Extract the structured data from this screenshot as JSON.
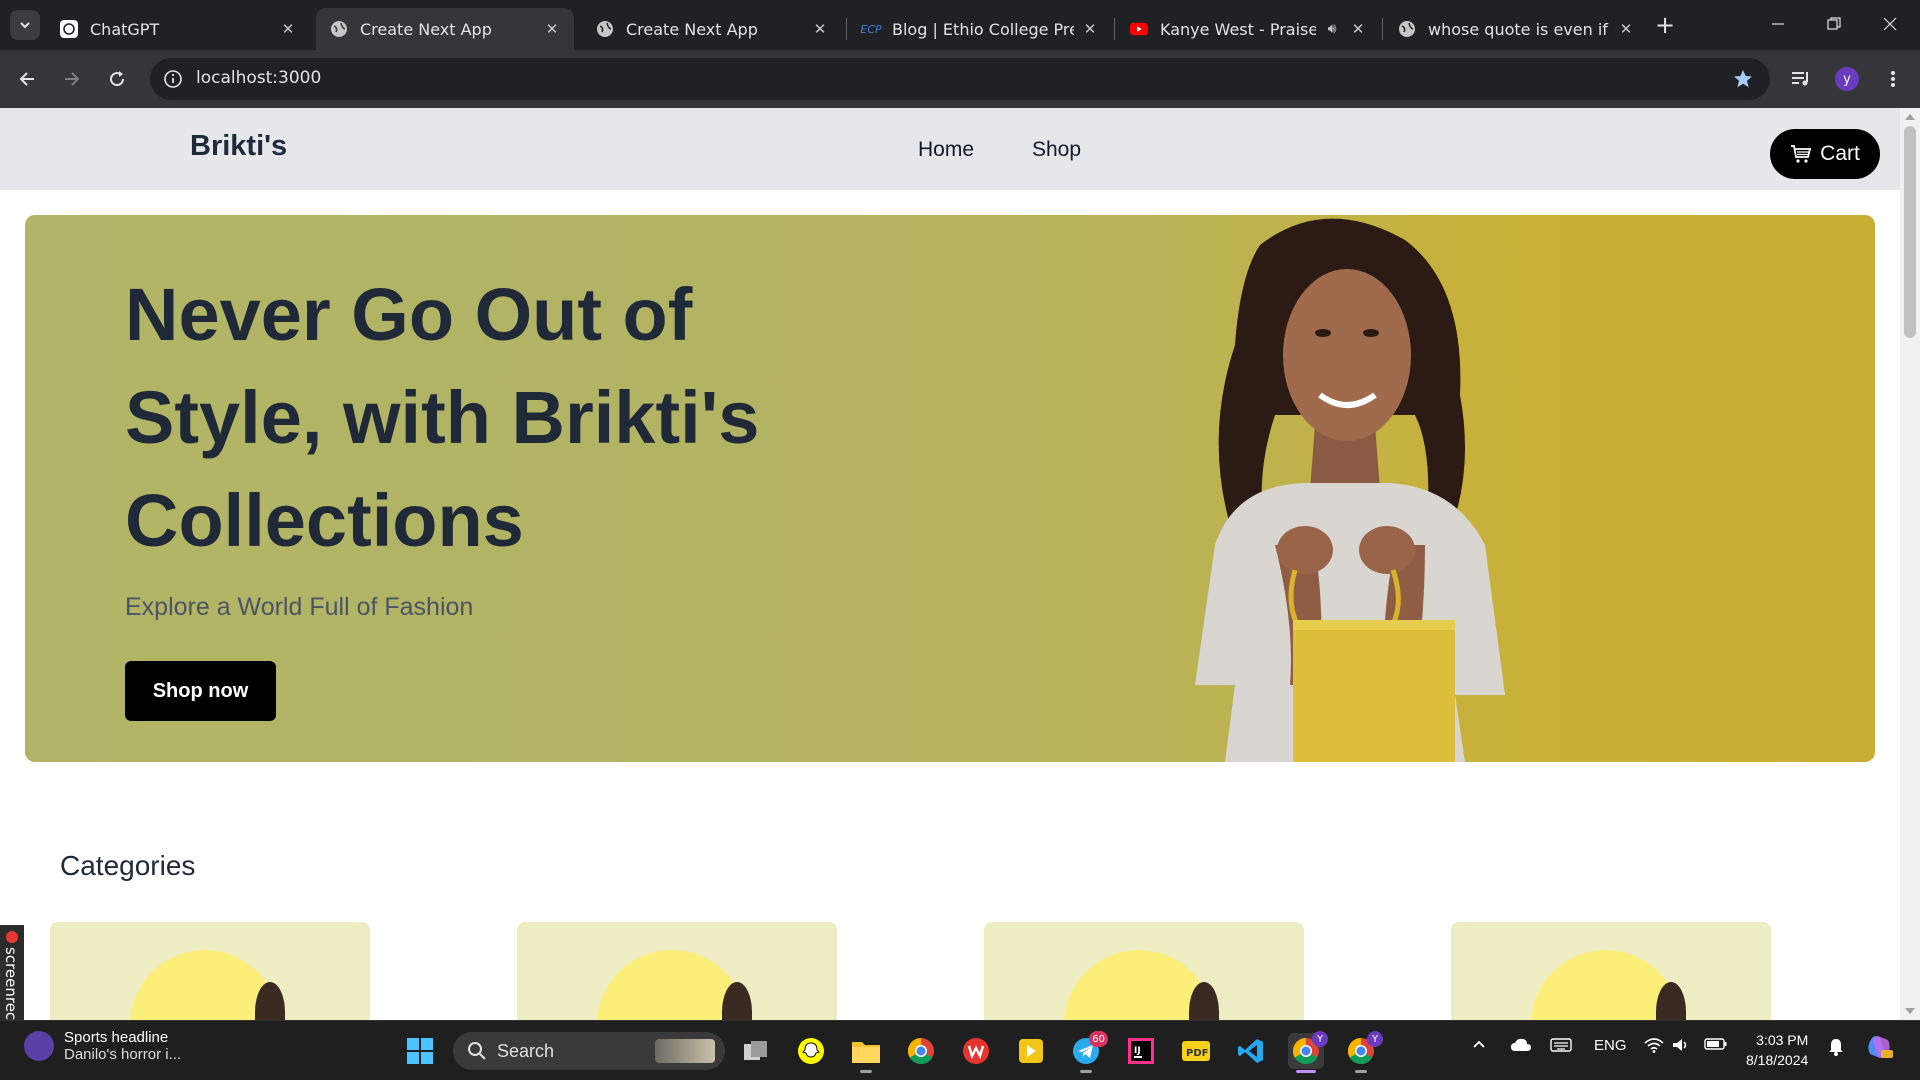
{
  "browser": {
    "tabs": [
      {
        "title": "ChatGPT",
        "favicon": "chatgpt-icon",
        "active": false
      },
      {
        "title": "Create Next App",
        "favicon": "globe-icon",
        "active": true
      },
      {
        "title": "Create Next App",
        "favicon": "globe-icon",
        "active": false
      },
      {
        "title": "Blog | Ethio College Prep",
        "favicon": "ecp-icon",
        "active": false
      },
      {
        "title": "Kanye West - Praise Go",
        "favicon": "youtube-icon",
        "active": false,
        "audio": true
      },
      {
        "title": "whose quote is even if you",
        "favicon": "globe-icon",
        "active": false
      }
    ],
    "url": "localhost:3000",
    "profile_initial": "y"
  },
  "site": {
    "brand": "Brikti's",
    "nav": {
      "home": "Home",
      "shop": "Shop"
    },
    "cart_label": "Cart",
    "hero": {
      "title": "Never Go Out of Style, with Brikti's Collections",
      "subtitle": "Explore a World Full of Fashion",
      "cta": "Shop now"
    },
    "categories_title": "Categories",
    "category_cards": 4
  },
  "screenrec": {
    "label": "screenrec"
  },
  "taskbar": {
    "widget": {
      "line1": "Sports headline",
      "line2": "Danilo's horror i..."
    },
    "search_label": "Search",
    "telegram_badge": "60",
    "chrome_badge": "Y",
    "language": "ENG",
    "time": "3:03 PM",
    "date": "8/18/2024"
  },
  "colors": {
    "accent_black": "#000000",
    "hero_olive": "#b2b467",
    "hero_yellow": "#c9ae34",
    "nav_gray": "#e5e7eb",
    "text_dark": "#1f2937"
  }
}
